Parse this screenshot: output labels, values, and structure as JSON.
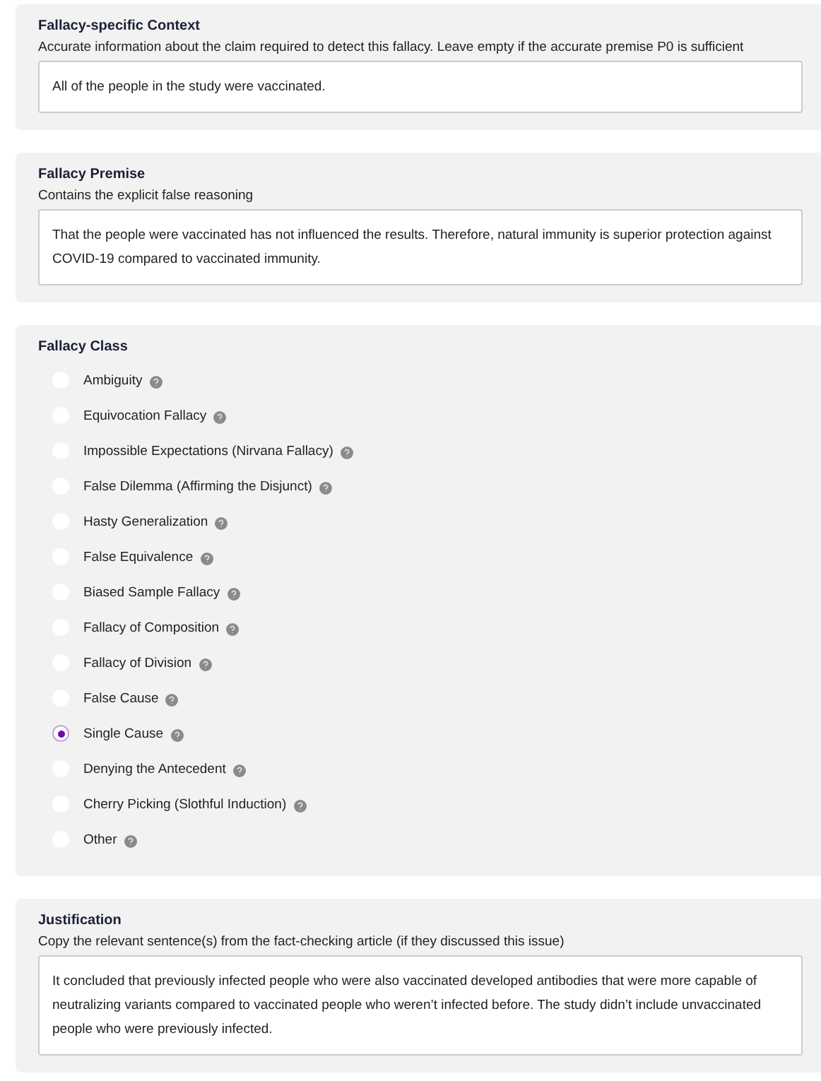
{
  "sections": [
    {
      "kind": "text",
      "title": "Fallacy-specific Context",
      "description": "Accurate information about the claim required to detect this fallacy. Leave empty if the accurate premise P0 is sufficient",
      "value": "All of the people in the study were vaccinated."
    },
    {
      "kind": "text",
      "title": "Fallacy Premise",
      "description": "Contains the explicit false reasoning",
      "value": "That the people were vaccinated has not influenced the results. Therefore, natural immunity is superior protection against COVID-19 compared to vaccinated immunity."
    },
    {
      "kind": "radio",
      "title": "Fallacy Class",
      "options": [
        {
          "label": "Ambiguity",
          "selected": false
        },
        {
          "label": "Equivocation Fallacy",
          "selected": false
        },
        {
          "label": "Impossible Expectations (Nirvana Fallacy)",
          "selected": false
        },
        {
          "label": "False Dilemma (Affirming the Disjunct)",
          "selected": false
        },
        {
          "label": "Hasty Generalization",
          "selected": false
        },
        {
          "label": "False Equivalence",
          "selected": false
        },
        {
          "label": "Biased Sample Fallacy",
          "selected": false
        },
        {
          "label": "Fallacy of Composition",
          "selected": false
        },
        {
          "label": "Fallacy of Division",
          "selected": false
        },
        {
          "label": "False Cause",
          "selected": false
        },
        {
          "label": "Single Cause",
          "selected": true
        },
        {
          "label": "Denying the Antecedent",
          "selected": false
        },
        {
          "label": "Cherry Picking (Slothful Induction)",
          "selected": false
        },
        {
          "label": "Other",
          "selected": false
        }
      ]
    },
    {
      "kind": "text",
      "title": "Justification",
      "description": "Copy the relevant sentence(s) from the fact-checking article (if they discussed this issue)",
      "value": "It concluded that previously infected people who were also vaccinated developed antibodies that were more capable of neutralizing variants compared to vaccinated people who weren’t infected before. The study didn’t include unvaccinated people who were previously infected."
    }
  ]
}
